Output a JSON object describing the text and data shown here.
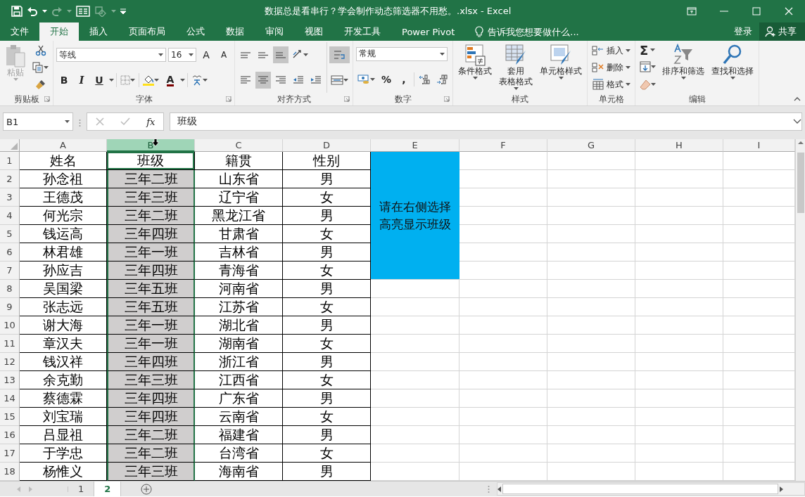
{
  "window": {
    "title": "数据总是看串行？学会制作动态筛选器不用愁。.xlsx - Excel"
  },
  "tabs": [
    {
      "label": "文件",
      "selected": false
    },
    {
      "label": "开始",
      "selected": true
    },
    {
      "label": "插入",
      "selected": false
    },
    {
      "label": "页面布局",
      "selected": false
    },
    {
      "label": "公式",
      "selected": false
    },
    {
      "label": "数据",
      "selected": false
    },
    {
      "label": "审阅",
      "selected": false
    },
    {
      "label": "视图",
      "selected": false
    },
    {
      "label": "开发工具",
      "selected": false
    },
    {
      "label": "Power Pivot",
      "selected": false
    }
  ],
  "tell_me": {
    "placeholder": "告诉我您想要做什么..."
  },
  "account": {
    "sign_in": "登录",
    "share": "共享"
  },
  "ribbon": {
    "groups": [
      {
        "kind": "clipboard",
        "label": "剪贴板",
        "paste": {
          "label": "粘贴",
          "disabled": true
        }
      },
      {
        "kind": "font",
        "label": "字体",
        "font_name": "等线",
        "font_size": "16",
        "grow": "A",
        "shrink": "A",
        "bold": "B",
        "italic": "I",
        "underline": "U",
        "font_color": "A"
      },
      {
        "kind": "alignment",
        "label": "对齐方式",
        "vertical_align": [
          {
            "selected": false
          },
          {
            "selected": false
          },
          {
            "selected": true
          }
        ],
        "horizontal_align": [
          {
            "selected": false
          },
          {
            "selected": true
          },
          {
            "selected": false
          }
        ],
        "wrap_text": {
          "selected": true
        }
      },
      {
        "kind": "number",
        "label": "数字",
        "format": "常规",
        "percent": "%",
        "comma": ","
      },
      {
        "kind": "styles",
        "label": "样式",
        "buttons": [
          [
            "条件格式"
          ],
          [
            "套用",
            "表格格式"
          ],
          [
            "单元格样式"
          ]
        ]
      },
      {
        "kind": "cells",
        "label": "单元格",
        "buttons": [
          "插入",
          "删除",
          "格式"
        ]
      },
      {
        "kind": "editing",
        "label": "编辑",
        "autosum": "Σ",
        "buttons": [
          "排序和筛选",
          "查找和选择"
        ]
      }
    ]
  },
  "formula_bar": {
    "name_box": "B1",
    "fx": "fx",
    "value": "班级"
  },
  "sheet": {
    "columns": [
      {
        "label": "A",
        "selected": false
      },
      {
        "label": "B",
        "selected": true
      },
      {
        "label": "C",
        "selected": false
      },
      {
        "label": "D",
        "selected": false
      },
      {
        "label": "E",
        "selected": false
      },
      {
        "label": "F",
        "selected": false
      },
      {
        "label": "G",
        "selected": false
      },
      {
        "label": "H",
        "selected": false
      },
      {
        "label": "I",
        "selected": false
      }
    ],
    "note": "请在右侧选择高亮显示班级",
    "rows": [
      {
        "number": "1",
        "cells": [
          "姓名",
          "班级",
          "籍贯",
          "性别"
        ],
        "class_highlighted": false
      },
      {
        "number": "2",
        "cells": [
          "孙念祖",
          "三年二班",
          "山东省",
          "男"
        ],
        "class_highlighted": true
      },
      {
        "number": "3",
        "cells": [
          "王德茂",
          "三年三班",
          "辽宁省",
          "女"
        ],
        "class_highlighted": true
      },
      {
        "number": "4",
        "cells": [
          "何光宗",
          "三年二班",
          "黑龙江省",
          "男"
        ],
        "class_highlighted": true
      },
      {
        "number": "5",
        "cells": [
          "钱运高",
          "三年四班",
          "甘肃省",
          "女"
        ],
        "class_highlighted": true
      },
      {
        "number": "6",
        "cells": [
          "林君雄",
          "三年一班",
          "吉林省",
          "男"
        ],
        "class_highlighted": true
      },
      {
        "number": "7",
        "cells": [
          "孙应吉",
          "三年四班",
          "青海省",
          "女"
        ],
        "class_highlighted": true
      },
      {
        "number": "8",
        "cells": [
          "吴国梁",
          "三年五班",
          "河南省",
          "男"
        ],
        "class_highlighted": true
      },
      {
        "number": "9",
        "cells": [
          "张志远",
          "三年五班",
          "江苏省",
          "女"
        ],
        "class_highlighted": true
      },
      {
        "number": "10",
        "cells": [
          "谢大海",
          "三年一班",
          "湖北省",
          "男"
        ],
        "class_highlighted": true
      },
      {
        "number": "11",
        "cells": [
          "章汉夫",
          "三年一班",
          "湖南省",
          "女"
        ],
        "class_highlighted": true
      },
      {
        "number": "12",
        "cells": [
          "钱汉祥",
          "三年四班",
          "浙江省",
          "男"
        ],
        "class_highlighted": true
      },
      {
        "number": "13",
        "cells": [
          "余克勤",
          "三年三班",
          "江西省",
          "女"
        ],
        "class_highlighted": true
      },
      {
        "number": "14",
        "cells": [
          "蔡德霖",
          "三年四班",
          "广东省",
          "男"
        ],
        "class_highlighted": true
      },
      {
        "number": "15",
        "cells": [
          "刘宝瑞",
          "三年四班",
          "云南省",
          "女"
        ],
        "class_highlighted": true
      },
      {
        "number": "16",
        "cells": [
          "吕显祖",
          "三年二班",
          "福建省",
          "男"
        ],
        "class_highlighted": true
      },
      {
        "number": "17",
        "cells": [
          "于学忠",
          "三年二班",
          "台湾省",
          "女"
        ],
        "class_highlighted": true
      },
      {
        "number": "18",
        "cells": [
          "杨惟义",
          "三年三班",
          "海南省",
          "男"
        ],
        "class_highlighted": true
      }
    ]
  },
  "sheet_tabs": [
    {
      "label": "1",
      "selected": false
    },
    {
      "label": "2",
      "selected": true
    }
  ]
}
